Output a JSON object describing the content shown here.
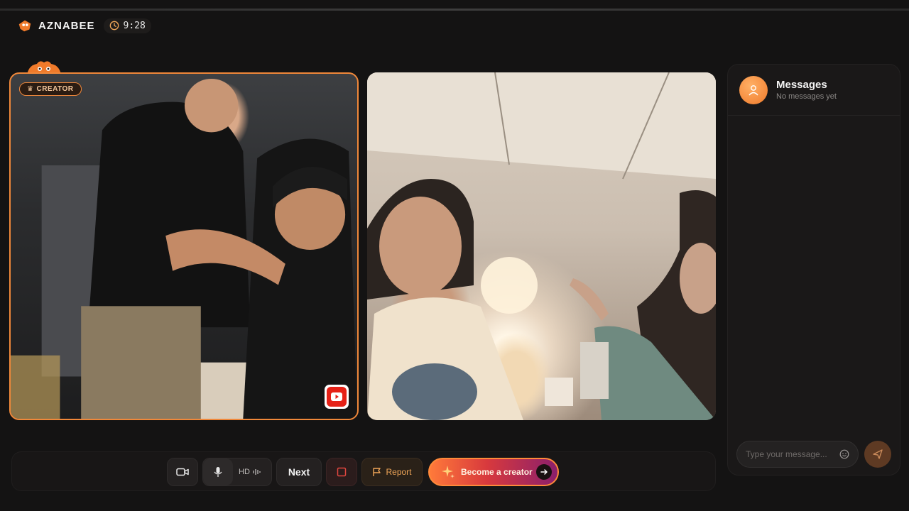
{
  "header": {
    "brand": "AZNABEE",
    "timer": "9:28",
    "brand_color": "#f07a2a"
  },
  "video_tiles": {
    "left": {
      "badge": "CREATOR",
      "border_color": "#f0883a",
      "overlay_icon": "youtube-icon"
    },
    "right": {}
  },
  "messages": {
    "title": "Messages",
    "subtitle": "No messages yet",
    "input_placeholder": "Type your message...",
    "avatar_icon": "user-icon",
    "send_icon": "send-icon",
    "emoji_icon": "emoji-icon"
  },
  "controls": {
    "camera_icon": "camera-icon",
    "mic_icon": "microphone-icon",
    "quality_label": "HD",
    "next_label": "Next",
    "stop_icon": "stop-icon",
    "report_label": "Report",
    "become_creator_label": "Become a creator"
  }
}
